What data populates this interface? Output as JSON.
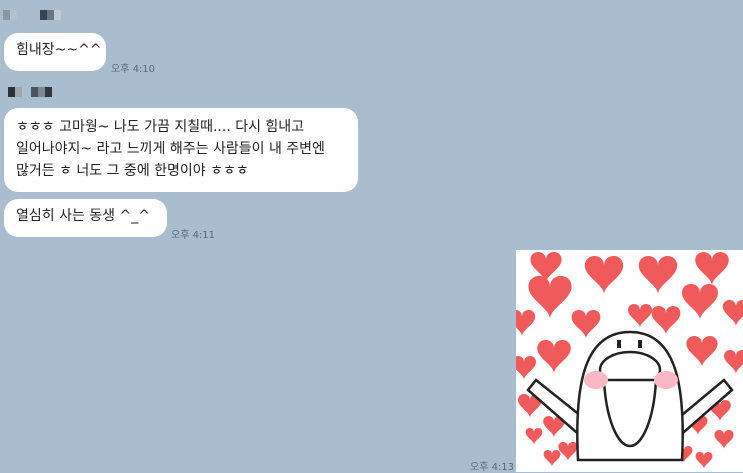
{
  "chat": {
    "messages": [
      {
        "text": "힘내장~~^^",
        "time": "오후 4:10"
      },
      {
        "lines": [
          "ㅎㅎㅎ 고마웡~ 나도 가끔 지칠때.... 다시 힘내고",
          "일어나야지~ 라고 느끼게 해주는 사람들이 내 주변엔",
          "많거든 ㅎ 너도 그 중에 한명이야 ㅎㅎㅎ"
        ]
      },
      {
        "text": "열심히 사는 동생 ^_^",
        "time": "오후 4:11"
      }
    ],
    "sticker": {
      "icon": "hearts-character-sticker",
      "time": "오후 4:13"
    }
  },
  "colors": {
    "background": "#a9bdce",
    "bubble": "#ffffff",
    "heart": "#f05a5a",
    "cheek": "#f8b8c4"
  }
}
